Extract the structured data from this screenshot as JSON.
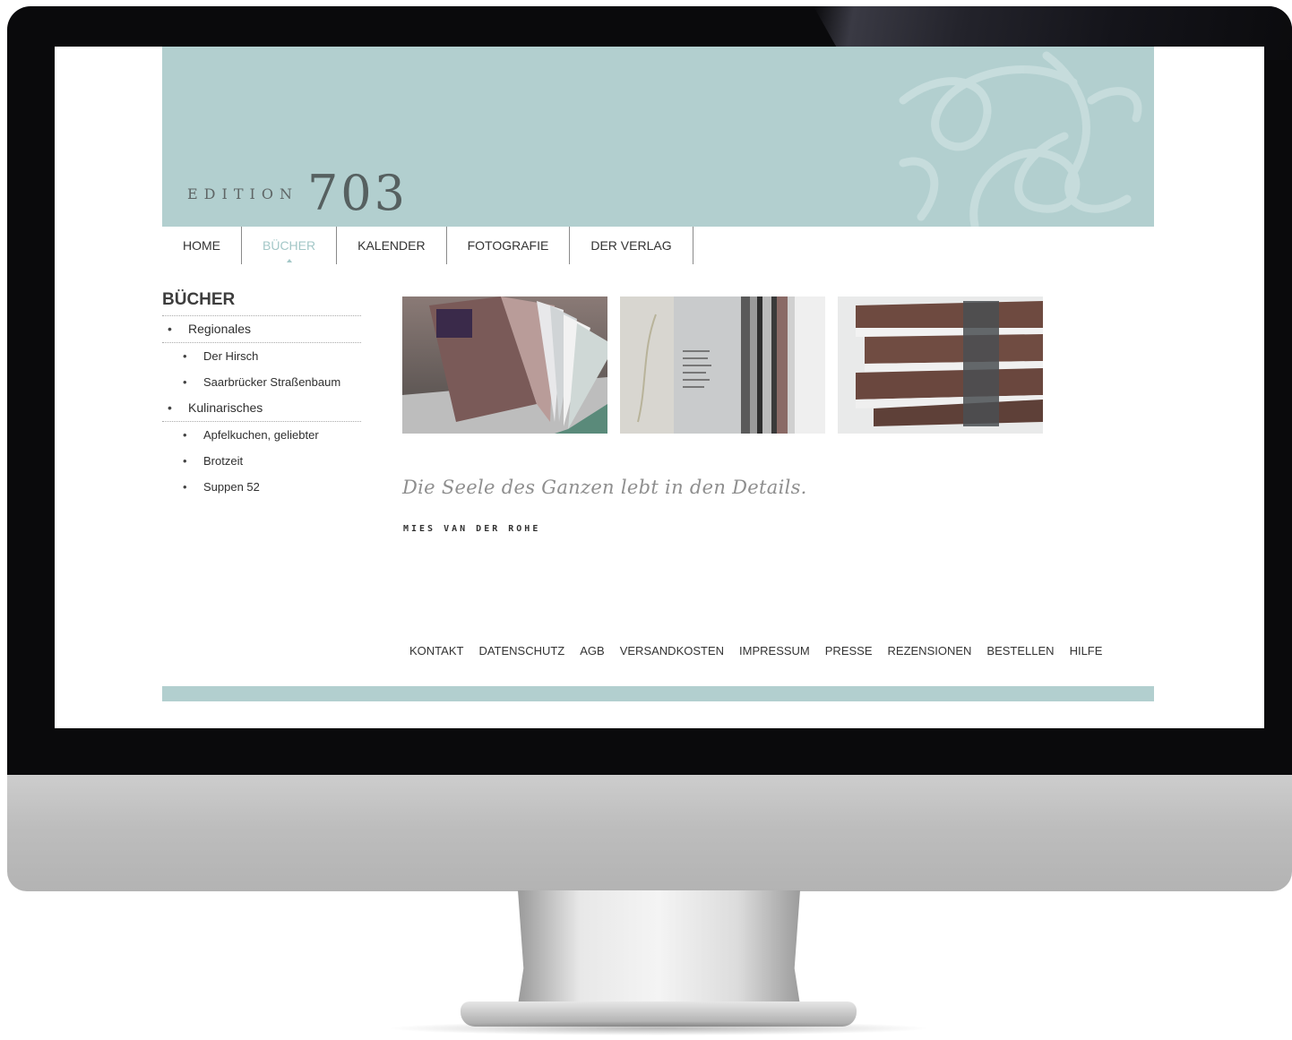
{
  "header": {
    "logo_word": "EDITION",
    "logo_number": "703"
  },
  "nav": {
    "items": [
      {
        "label": "HOME",
        "active": false
      },
      {
        "label": "BÜCHER",
        "active": true
      },
      {
        "label": "KALENDER",
        "active": false
      },
      {
        "label": "FOTOGRAFIE",
        "active": false
      },
      {
        "label": "DER VERLAG",
        "active": false
      }
    ]
  },
  "sidebar": {
    "title": "BÜCHER",
    "items": [
      {
        "label": "Regionales",
        "level": 1
      },
      {
        "label": "Der Hirsch",
        "level": 2
      },
      {
        "label": "Saarbrücker Straßenbaum",
        "level": 2
      },
      {
        "label": "Kulinarisches",
        "level": 1
      },
      {
        "label": "Apfelkuchen, geliebter",
        "level": 2
      },
      {
        "label": "Brotzeit",
        "level": 2
      },
      {
        "label": "Suppen 52",
        "level": 2
      }
    ]
  },
  "quote": {
    "text": "Die Seele des Ganzen lebt in den Details.",
    "author": "MIES VAN DER ROHE"
  },
  "footer": {
    "links": [
      "KONTAKT",
      "DATENSCHUTZ",
      "AGB",
      "VERSANDKOSTEN",
      "IMPRESSUM",
      "PRESSE",
      "REZENSIONEN",
      "BESTELLEN",
      "HILFE"
    ]
  },
  "colors": {
    "brand_teal": "#b2cfcf",
    "active_nav": "#a3c7c7",
    "bezel": "#0a0a0c"
  }
}
